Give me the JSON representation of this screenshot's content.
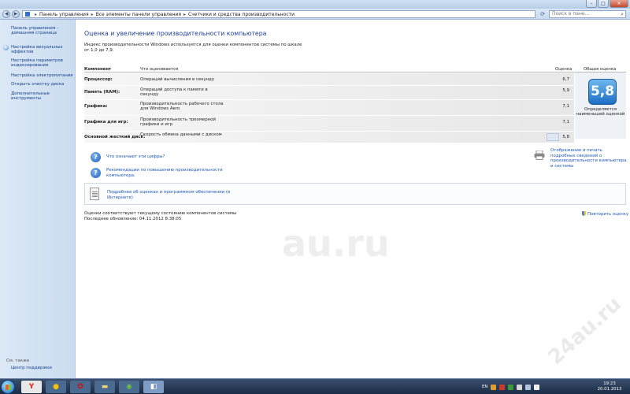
{
  "address": {
    "crumbs": [
      "Панель управления",
      "Все элементы панели управления",
      "Счетчики и средства производительности"
    ],
    "search_placeholder": "Поиск в пане..."
  },
  "sidebar": {
    "items": [
      {
        "label": "Панель управления - домашняя страница",
        "icon": "none"
      },
      {
        "label": "Настройка визуальных эффектов",
        "icon": "shield-icon"
      },
      {
        "label": "Настройка параметров индексирования",
        "icon": "none"
      },
      {
        "label": "Настройка электропитания",
        "icon": "none"
      },
      {
        "label": "Открыть очистку диска",
        "icon": "none"
      },
      {
        "label": "Дополнительные инструменты",
        "icon": "none"
      }
    ],
    "see_also": "См. также",
    "support_link": "Центр поддержки"
  },
  "main": {
    "title": "Оценка и увеличение производительности компьютера",
    "intro": "Индекс производительности Windows используется для оценки компонентов системы по шкале от 1,0 до 7,9.",
    "table": {
      "headers": {
        "component": "Компонент",
        "what": "Что оценивается",
        "score": "Оценка",
        "overall": "Общая оценка"
      },
      "rows": [
        {
          "component": "Процессор:",
          "what": "Операций вычисления в секунду",
          "score": "6,7"
        },
        {
          "component": "Память (RAM):",
          "what": "Операций доступа к памяти в секунду",
          "score": "5,9"
        },
        {
          "component": "Графика:",
          "what": "Производительность рабочего стола для Windows Aero",
          "score": "7,1"
        },
        {
          "component": "Графика для игр:",
          "what": "Производительность трехмерной графики и игр",
          "score": "7,1"
        },
        {
          "component": "Основной жесткий диск:",
          "what": "Скорость обмена данными с диском",
          "score": "5,8"
        }
      ],
      "base_score": "5,8",
      "overall_note": "Определяется наименьшей оценкой"
    },
    "links": {
      "what_means": "Что означают эти цифры?",
      "tips": "Рекомендации по повышению производительности компьютера.",
      "print": "Отображение и печать подробных сведений о производительности компьютера и системы",
      "online": "Подробнее об оценках и программном обеспечении (в Интернете)"
    },
    "status": {
      "current": "Оценки соответствуют текущему состоянию компонентов системы",
      "last_update": "Последнее обновление: 04.11.2012 8:38:05"
    },
    "rerun": "Повторить оценку"
  },
  "taskbar": {
    "items": [
      {
        "name": "yandex-browser-icon",
        "glyph": "Y",
        "bg": "#e8e8e8",
        "fg": "#e2231a"
      },
      {
        "name": "chrome-icon",
        "glyph": "●",
        "bg": "#4a6a8f",
        "fg": "#f4c20d"
      },
      {
        "name": "opera-icon",
        "glyph": "O",
        "bg": "#4a6a8f",
        "fg": "#cc0f16"
      },
      {
        "name": "explorer-icon",
        "glyph": "▬",
        "bg": "#4a6a8f",
        "fg": "#f1d37a"
      },
      {
        "name": "media-icon",
        "glyph": "◉",
        "bg": "#4a6a8f",
        "fg": "#6ac04b"
      },
      {
        "name": "control-panel-icon",
        "glyph": "◧",
        "bg": "#7f9dc4",
        "fg": "#ffffff"
      }
    ],
    "lang": "EN",
    "time": "19:23",
    "date": "20.01.2013"
  },
  "colors": {
    "accent": "#1e3c96",
    "link": "#1b58b8",
    "badge": "#1d6ec5"
  }
}
